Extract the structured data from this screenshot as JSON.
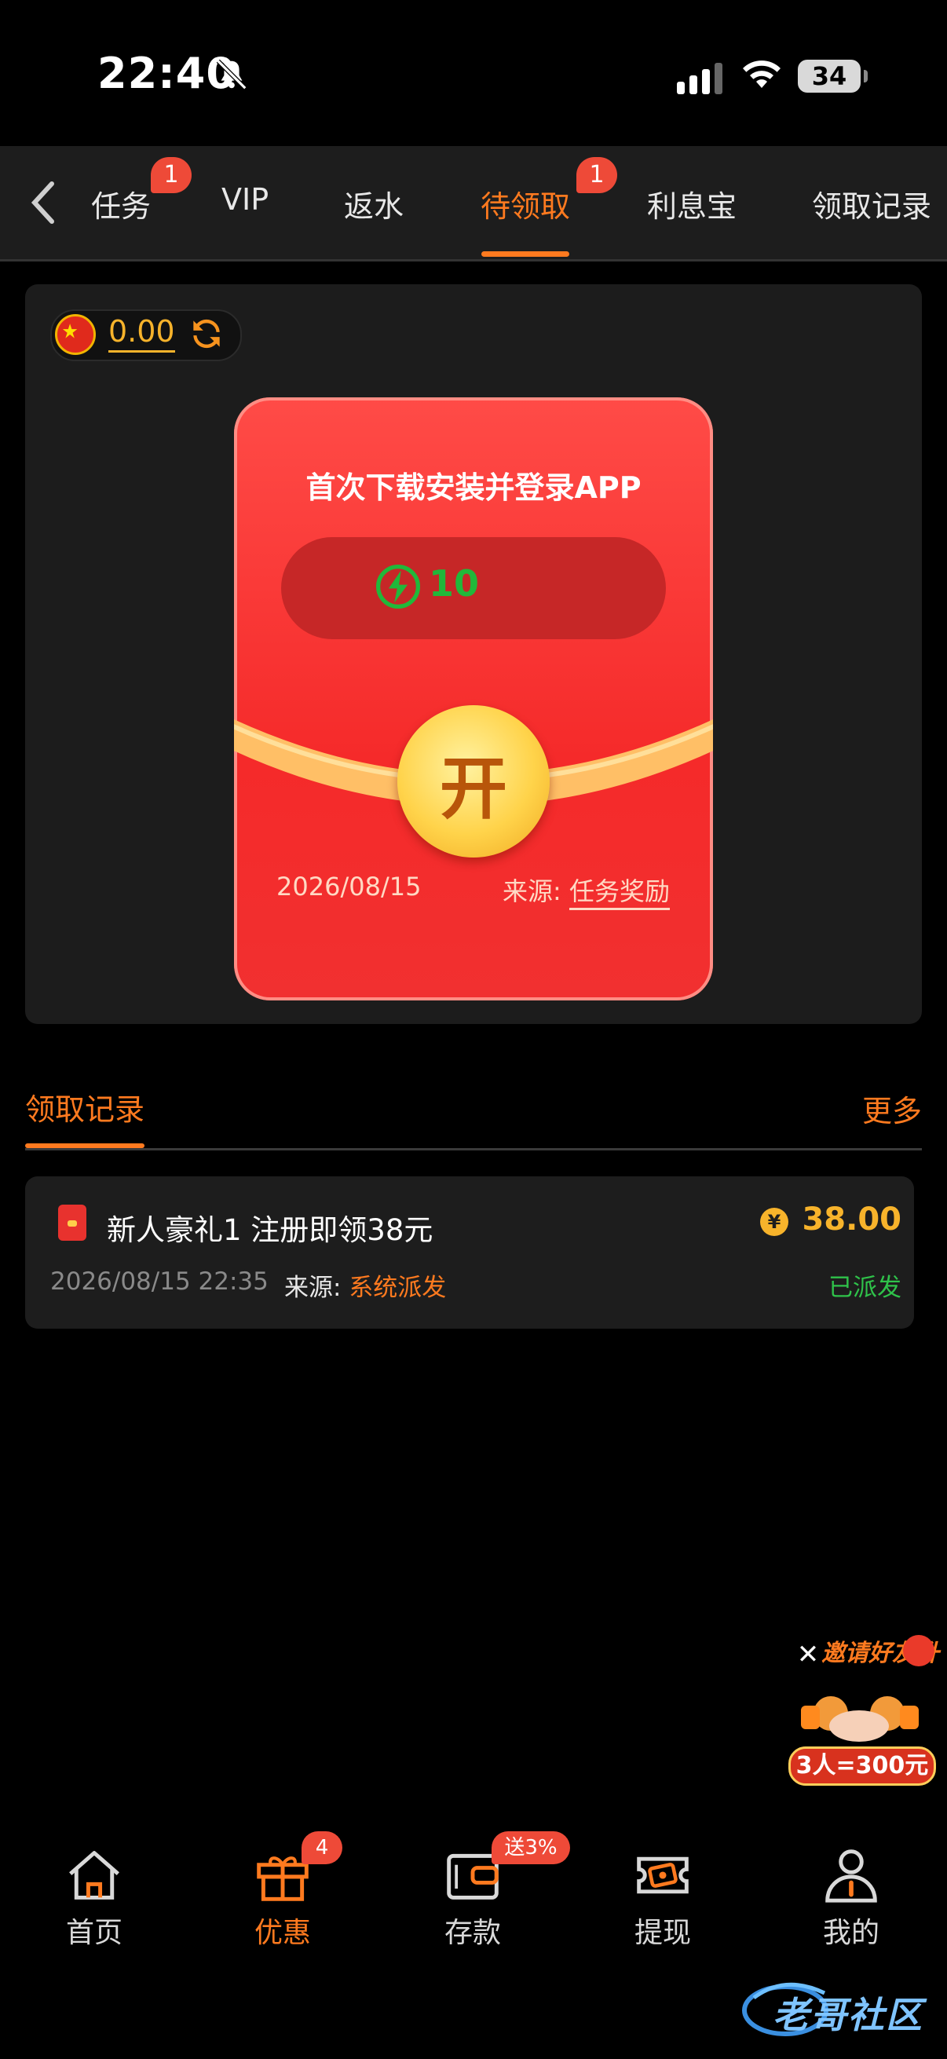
{
  "status_bar": {
    "time": "22:40",
    "battery": "34"
  },
  "tabs": [
    {
      "label": "任务",
      "badge": "1"
    },
    {
      "label": "VIP"
    },
    {
      "label": "返水"
    },
    {
      "label": "待领取",
      "badge": "1",
      "active": true
    },
    {
      "label": "利息宝"
    },
    {
      "label": "领取记录"
    }
  ],
  "balance": {
    "value": "0.00"
  },
  "envelope": {
    "title": "首次下载安装并登录APP",
    "points": "10",
    "open_label": "开",
    "date": "2026/08/15",
    "source_label": "来源:",
    "source_value": "任务奖励"
  },
  "records": {
    "title": "领取记录",
    "more": "更多",
    "items": [
      {
        "title": "新人豪礼1 注册即领38元",
        "time": "2026/08/15 22:35",
        "source_label": "来源:",
        "source_value": "系统派发",
        "currency": "¥",
        "amount": "38.00",
        "status": "已派发"
      }
    ]
  },
  "promo": {
    "title": "邀请好友升",
    "label": "3人=300元"
  },
  "nav": [
    {
      "label": "首页"
    },
    {
      "label": "优惠",
      "badge": "4",
      "active": true
    },
    {
      "label": "存款",
      "badge": "送3%"
    },
    {
      "label": "提现"
    },
    {
      "label": "我的"
    }
  ],
  "watermark": "老哥社区",
  "colors": {
    "accent": "#ff7a1f",
    "envelope_red": "#f52a2a",
    "gold": "#f7b32b",
    "success": "#2fc24a",
    "badge": "#ee4a38"
  }
}
